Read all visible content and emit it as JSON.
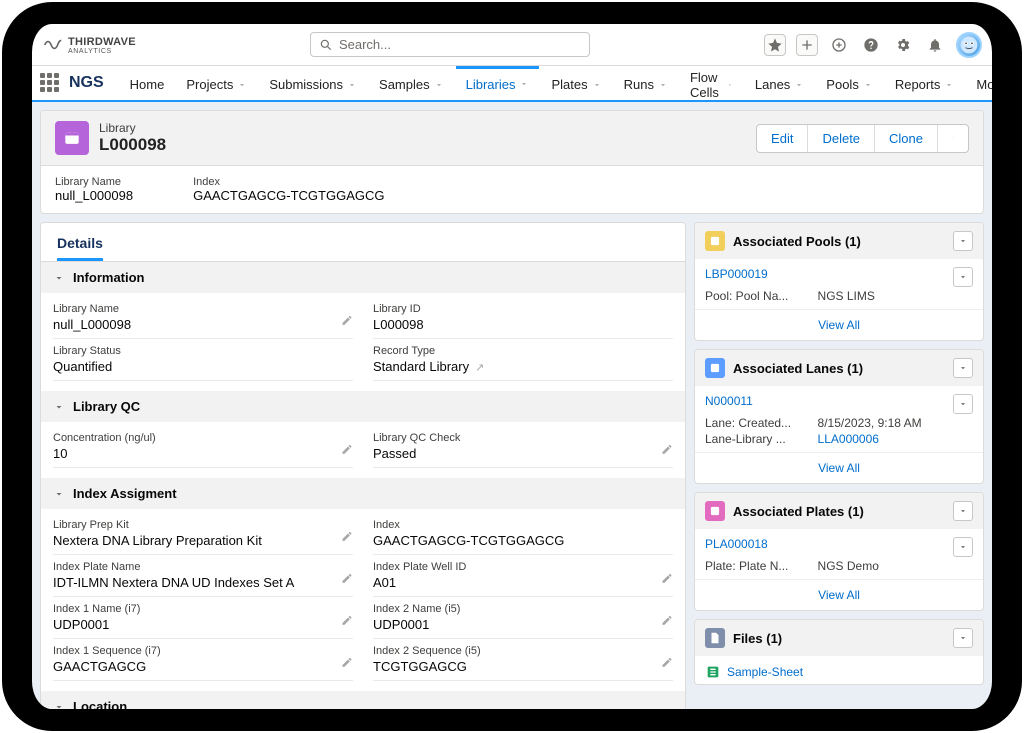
{
  "brand": {
    "name1": "THIRDWAVE",
    "name2": "ANALYTICS"
  },
  "search": {
    "placeholder": "Search..."
  },
  "nav": {
    "app": "NGS",
    "items": [
      {
        "label": "Home",
        "dropdown": false
      },
      {
        "label": "Projects",
        "dropdown": true
      },
      {
        "label": "Submissions",
        "dropdown": true
      },
      {
        "label": "Samples",
        "dropdown": true
      },
      {
        "label": "Libraries",
        "dropdown": true,
        "active": true
      },
      {
        "label": "Plates",
        "dropdown": true
      },
      {
        "label": "Runs",
        "dropdown": true
      },
      {
        "label": "Flow Cells",
        "dropdown": true
      },
      {
        "label": "Lanes",
        "dropdown": true
      },
      {
        "label": "Pools",
        "dropdown": true
      },
      {
        "label": "Reports",
        "dropdown": true
      },
      {
        "label": "More",
        "dropdown": true
      }
    ]
  },
  "record": {
    "object_label": "Library",
    "name": "L000098",
    "actions": {
      "edit": "Edit",
      "delete": "Delete",
      "clone": "Clone"
    },
    "highlights": {
      "library_name": {
        "label": "Library Name",
        "value": "null_L000098"
      },
      "index": {
        "label": "Index",
        "value": "GAACTGAGCG-TCGTGGAGCG"
      }
    }
  },
  "details": {
    "tab_label": "Details",
    "sections": {
      "information": {
        "title": "Information",
        "library_name_label": "Library Name",
        "library_name": "null_L000098",
        "library_id_label": "Library ID",
        "library_id": "L000098",
        "library_status_label": "Library Status",
        "library_status": "Quantified",
        "record_type_label": "Record Type",
        "record_type": "Standard Library"
      },
      "qc": {
        "title": "Library QC",
        "conc_label": "Concentration (ng/ul)",
        "conc": "10",
        "qc_check_label": "Library QC Check",
        "qc_check": "Passed"
      },
      "idx": {
        "title": "Index Assigment",
        "prep_kit_label": "Library Prep Kit",
        "prep_kit": "Nextera DNA Library Preparation Kit",
        "index_label": "Index",
        "index": "GAACTGAGCG-TCGTGGAGCG",
        "plate_name_label": "Index Plate Name",
        "plate_name": "IDT-ILMN Nextera DNA UD Indexes Set A",
        "well_label": "Index Plate Well ID",
        "well": "A01",
        "i1name_label": "Index 1 Name (i7)",
        "i1name": "UDP0001",
        "i2name_label": "Index 2 Name (i5)",
        "i2name": "UDP0001",
        "i1seq_label": "Index 1 Sequence (i7)",
        "i1seq": "GAACTGAGCG",
        "i2seq_label": "Index 2 Sequence (i5)",
        "i2seq": "TCGTGGAGCG"
      },
      "location": {
        "title": "Location"
      }
    }
  },
  "related": {
    "pools": {
      "title": "Associated Pools (1)",
      "icon_color": "#f2cf5b",
      "item_link": "LBP000019",
      "row1_k": "Pool: Pool Na...",
      "row1_v": "NGS LIMS",
      "view_all": "View All"
    },
    "lanes": {
      "title": "Associated Lanes (1)",
      "icon_color": "#5c9dff",
      "item_link": "N000011",
      "row1_k": "Lane: Created...",
      "row1_v": "8/15/2023, 9:18 AM",
      "row2_k": "Lane-Library ...",
      "row2_v": "LLA000006",
      "view_all": "View All"
    },
    "plates": {
      "title": "Associated Plates (1)",
      "icon_color": "#e36bbf",
      "item_link": "PLA000018",
      "row1_k": "Plate: Plate N...",
      "row1_v": "NGS Demo",
      "view_all": "View All"
    },
    "files": {
      "title": "Files (1)",
      "icon_color": "#7f8eaa",
      "item_link": "Sample-Sheet"
    }
  }
}
